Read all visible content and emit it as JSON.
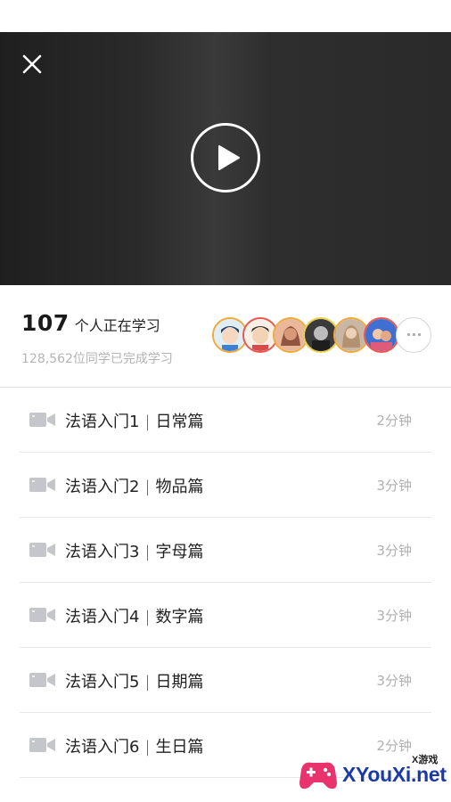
{
  "video": {
    "close_icon": "close-icon",
    "play_icon": "play-icon"
  },
  "stats": {
    "learning_count": "107",
    "learning_text": "个人正在学习",
    "completed_text": "128,562位同学已完成学习",
    "more_icon": "more-horizontal-icon",
    "avatar_border_colors": [
      "#f0a93a",
      "#e8574f",
      "#f0a93a",
      "#e9d24a",
      "#f0a93a",
      "#e8574f"
    ]
  },
  "lessons": [
    {
      "name": "法语入门1",
      "topic": "日常篇",
      "duration": "2分钟"
    },
    {
      "name": "法语入门2",
      "topic": "物品篇",
      "duration": "3分钟"
    },
    {
      "name": "法语入门3",
      "topic": "字母篇",
      "duration": "3分钟"
    },
    {
      "name": "法语入门4",
      "topic": "数字篇",
      "duration": "3分钟"
    },
    {
      "name": "法语入门5",
      "topic": "日期篇",
      "duration": "3分钟"
    },
    {
      "name": "法语入门6",
      "topic": "生日篇",
      "duration": "2分钟"
    }
  ],
  "lesson_separator": "|",
  "lesson_icon": "video-camera-icon",
  "watermark": {
    "small_text": "X游戏",
    "main_text": "XYouXi.net"
  },
  "colors": {
    "video_bg": "#2a2a2a",
    "muted_text": "#b4b4b4",
    "camera_icon": "#c4c6cc"
  }
}
